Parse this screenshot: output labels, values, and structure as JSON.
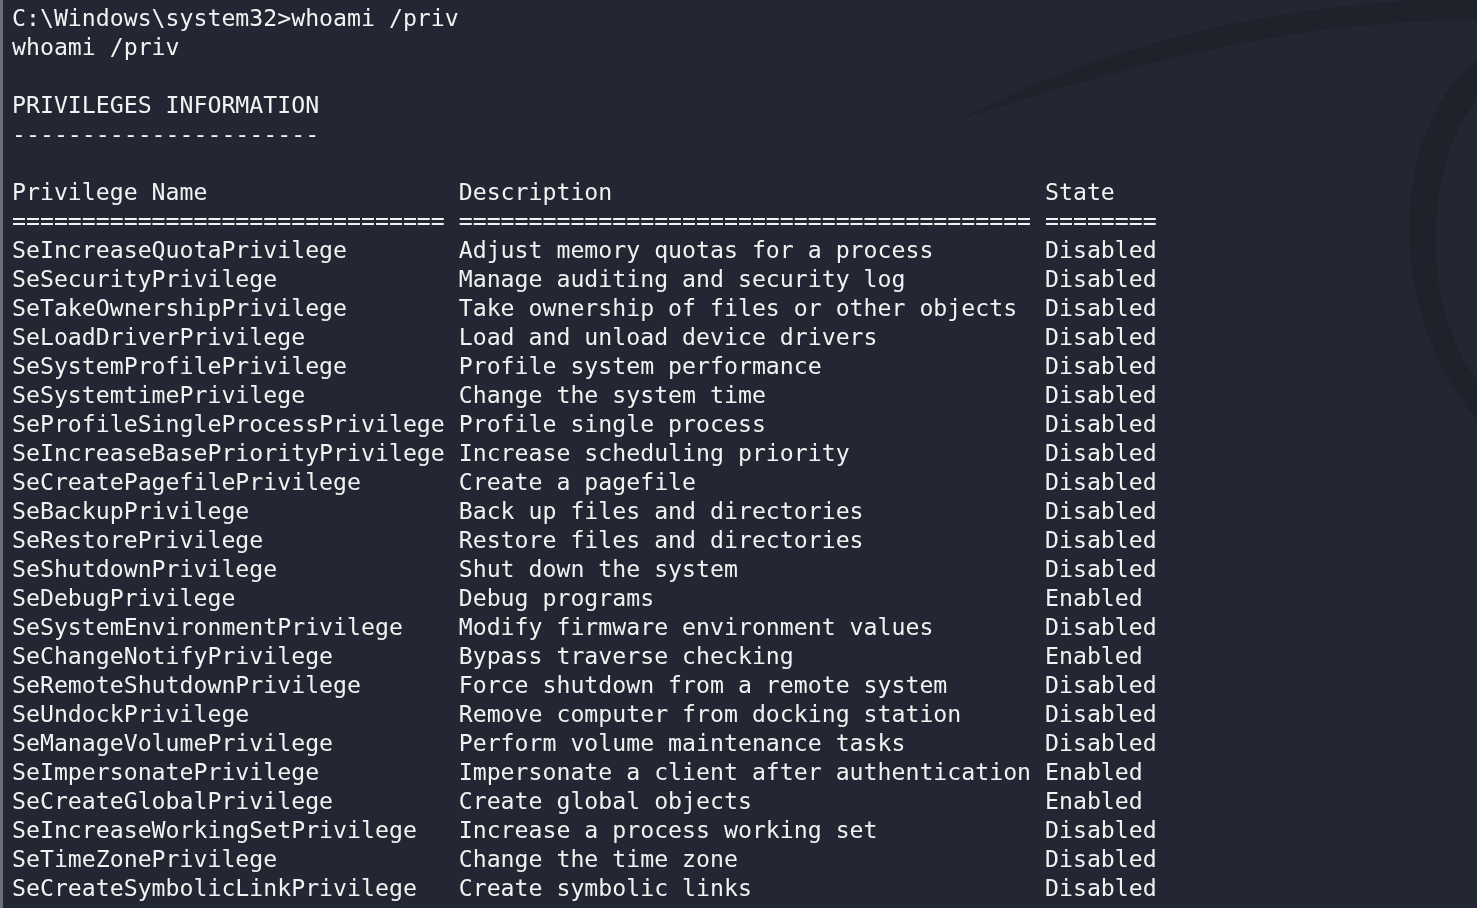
{
  "terminal": {
    "lines": [
      "C:\\Windows\\system32>whoami /priv",
      "whoami /priv",
      "PRIVILEGES INFORMATION",
      "----------------------"
    ],
    "table": {
      "columns": [
        {
          "heading": "Privilege Name",
          "rule": "==============================="
        },
        {
          "heading": "Description",
          "rule": "========================================="
        },
        {
          "heading": "State",
          "rule": "========"
        }
      ],
      "rows": [
        {
          "name": "SeIncreaseQuotaPrivilege",
          "description": "Adjust memory quotas for a process",
          "state": "Disabled"
        },
        {
          "name": "SeSecurityPrivilege",
          "description": "Manage auditing and security log",
          "state": "Disabled"
        },
        {
          "name": "SeTakeOwnershipPrivilege",
          "description": "Take ownership of files or other objects",
          "state": "Disabled"
        },
        {
          "name": "SeLoadDriverPrivilege",
          "description": "Load and unload device drivers",
          "state": "Disabled"
        },
        {
          "name": "SeSystemProfilePrivilege",
          "description": "Profile system performance",
          "state": "Disabled"
        },
        {
          "name": "SeSystemtimePrivilege",
          "description": "Change the system time",
          "state": "Disabled"
        },
        {
          "name": "SeProfileSingleProcessPrivilege",
          "description": "Profile single process",
          "state": "Disabled"
        },
        {
          "name": "SeIncreaseBasePriorityPrivilege",
          "description": "Increase scheduling priority",
          "state": "Disabled"
        },
        {
          "name": "SeCreatePagefilePrivilege",
          "description": "Create a pagefile",
          "state": "Disabled"
        },
        {
          "name": "SeBackupPrivilege",
          "description": "Back up files and directories",
          "state": "Disabled"
        },
        {
          "name": "SeRestorePrivilege",
          "description": "Restore files and directories",
          "state": "Disabled"
        },
        {
          "name": "SeShutdownPrivilege",
          "description": "Shut down the system",
          "state": "Disabled"
        },
        {
          "name": "SeDebugPrivilege",
          "description": "Debug programs",
          "state": "Enabled"
        },
        {
          "name": "SeSystemEnvironmentPrivilege",
          "description": "Modify firmware environment values",
          "state": "Disabled"
        },
        {
          "name": "SeChangeNotifyPrivilege",
          "description": "Bypass traverse checking",
          "state": "Enabled"
        },
        {
          "name": "SeRemoteShutdownPrivilege",
          "description": "Force shutdown from a remote system",
          "state": "Disabled"
        },
        {
          "name": "SeUndockPrivilege",
          "description": "Remove computer from docking station",
          "state": "Disabled"
        },
        {
          "name": "SeManageVolumePrivilege",
          "description": "Perform volume maintenance tasks",
          "state": "Disabled"
        },
        {
          "name": "SeImpersonatePrivilege",
          "description": "Impersonate a client after authentication",
          "state": "Enabled"
        },
        {
          "name": "SeCreateGlobalPrivilege",
          "description": "Create global objects",
          "state": "Enabled"
        },
        {
          "name": "SeIncreaseWorkingSetPrivilege",
          "description": "Increase a process working set",
          "state": "Disabled"
        },
        {
          "name": "SeTimeZonePrivilege",
          "description": "Change the time zone",
          "state": "Disabled"
        },
        {
          "name": "SeCreateSymbolicLinkPrivilege",
          "description": "Create symbolic links",
          "state": "Disabled"
        }
      ]
    }
  }
}
